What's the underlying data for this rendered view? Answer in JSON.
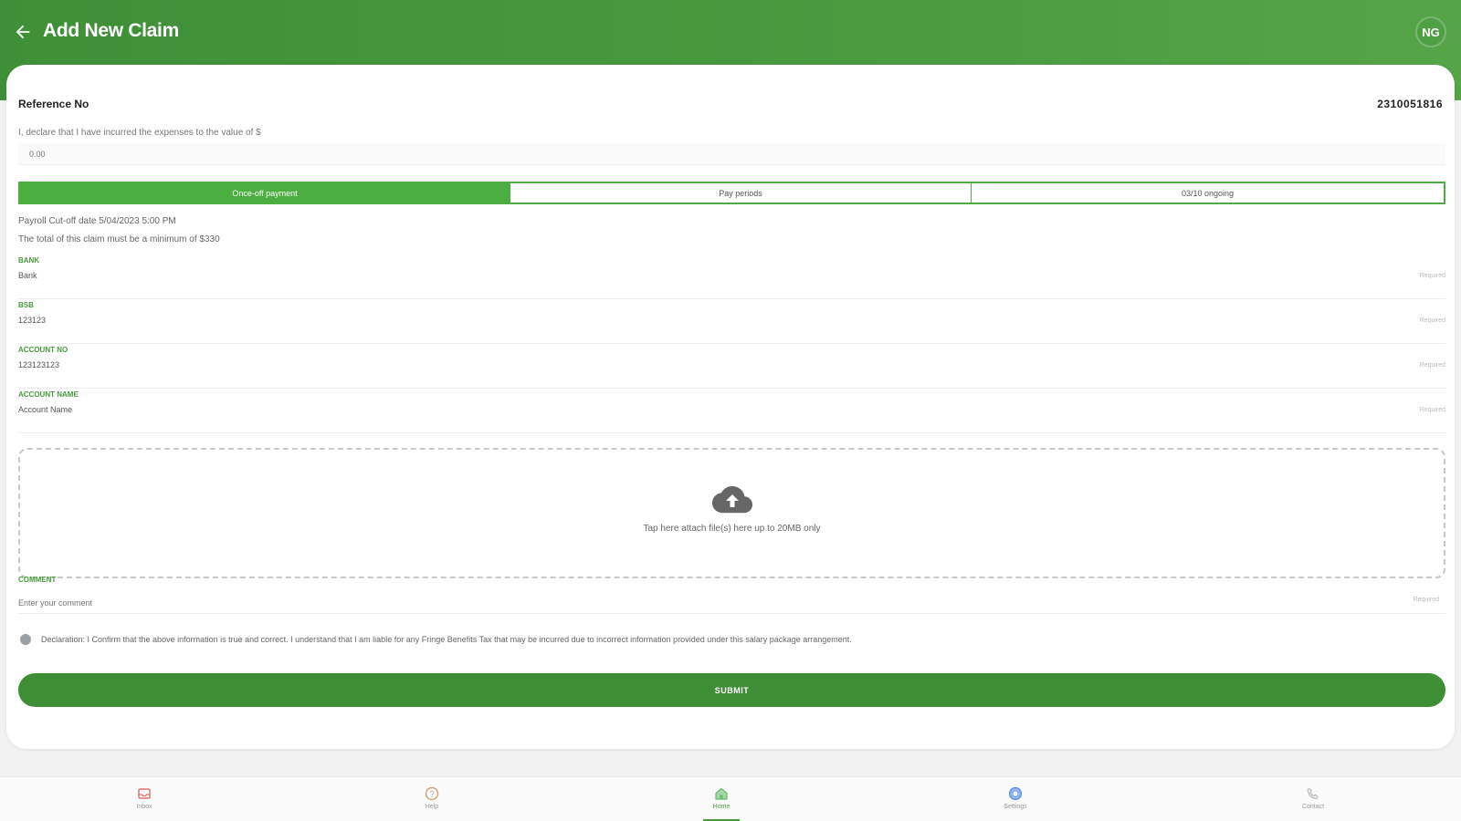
{
  "header": {
    "title": "Add New Claim",
    "avatar_initials": "NG"
  },
  "form": {
    "reference_label": "Reference No",
    "reference_value": "2310051816",
    "declare_text": "I, declare that I have incurred the expenses to the value of $",
    "amount_placeholder": "0.00",
    "tabs": [
      {
        "label": "Once-off payment",
        "active": true
      },
      {
        "label": "Pay periods",
        "active": false
      },
      {
        "label": "03/10 ongoing",
        "active": false
      }
    ],
    "payroll_cutoff": "Payroll Cut-off date 5/04/2023 5:00 PM",
    "minimum_note": "The total of this claim must be a minimum of $330",
    "fields": [
      {
        "label": "BANK",
        "value": "Bank",
        "hint": "Required"
      },
      {
        "label": "BSB",
        "value": "123123",
        "hint": "Required"
      },
      {
        "label": "ACCOUNT NO",
        "value": "123123123",
        "hint": "Required"
      },
      {
        "label": "ACCOUNT NAME",
        "value": "Account Name",
        "hint": "Required"
      }
    ],
    "upload_text": "Tap here attach file(s) here up to 20MB only",
    "comment_label": "COMMENT",
    "comment_placeholder": "Enter your comment",
    "comment_hint": "Required",
    "declaration": "Declaration: I Confirm that the above information is true and correct. I understand that I am liable for any Fringe Benefits Tax that may be incurred due to incorrect information provided under this salary package arrangement.",
    "submit_label": "SUBMIT"
  },
  "bottom_nav": [
    {
      "label": "Inbox",
      "icon": "inbox-icon",
      "color": "#e57373",
      "active": false
    },
    {
      "label": "Help",
      "icon": "help-icon",
      "color": "#d4a373",
      "active": false
    },
    {
      "label": "Home",
      "icon": "home-icon",
      "color": "#66bb6a",
      "active": true
    },
    {
      "label": "Settings",
      "icon": "settings-icon",
      "color": "#5c8fe6",
      "active": false
    },
    {
      "label": "Contact",
      "icon": "phone-icon",
      "color": "#bbbbbb",
      "active": false
    }
  ],
  "colors": {
    "primary": "#4a9a40",
    "tab_active": "#4cad40",
    "submit": "#3e8e36"
  }
}
